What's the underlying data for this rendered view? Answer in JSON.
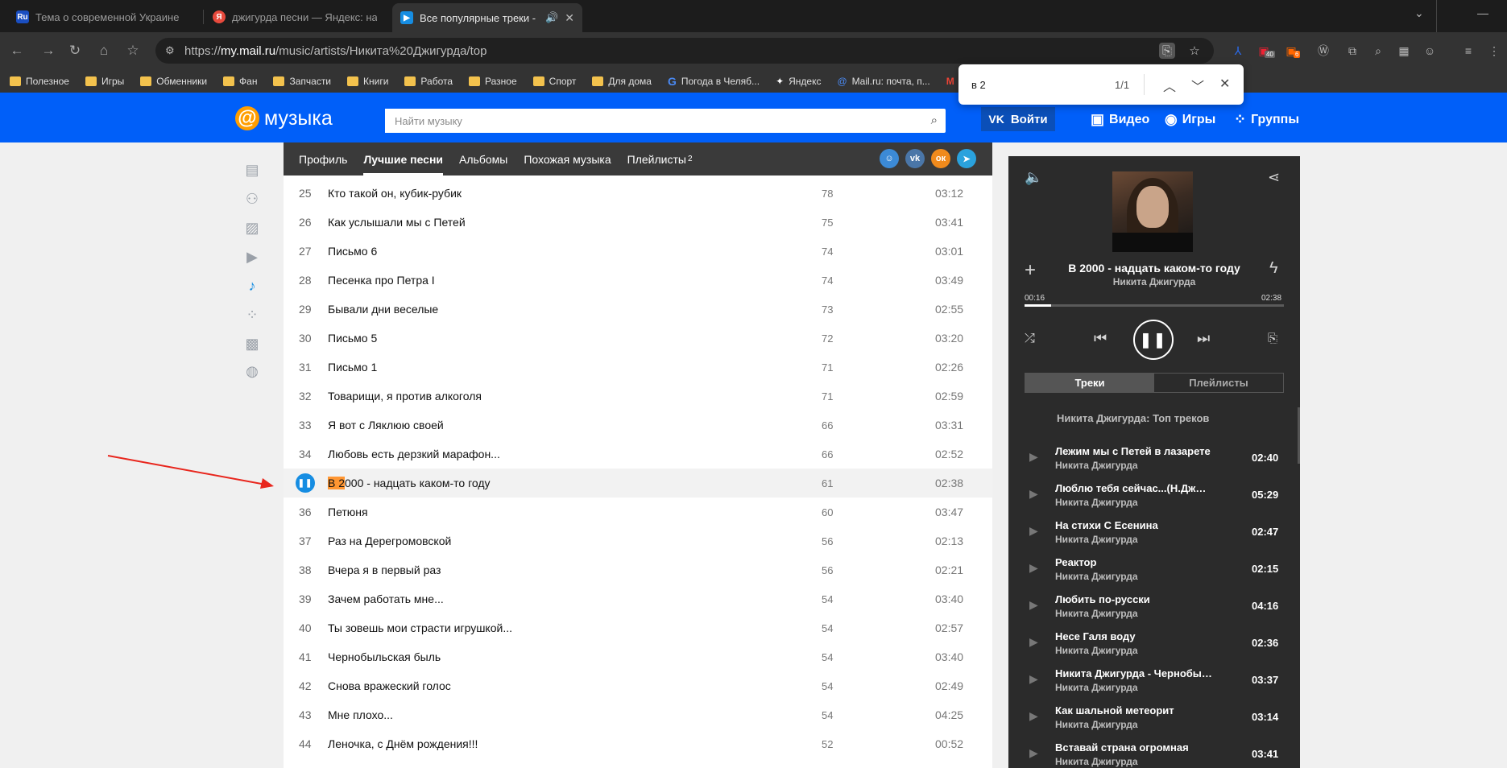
{
  "browser": {
    "tabs": [
      {
        "icon_text": "Ru",
        "icon_color": "#1a4ec0",
        "title": "Тема о современной Украине"
      },
      {
        "icon_text": "Я",
        "icon_color": "#e84a3d",
        "title": "джигурда песни — Яндекс: нашлось"
      },
      {
        "icon_text": "▶",
        "icon_color": "#168de2",
        "title": "Все популярные треки - Н",
        "active": true,
        "audio": "🔊"
      }
    ],
    "url_scheme": "https://",
    "url_host": "my.mail.ru",
    "url_path": "/music/artists/Никита%20Джигурда/top",
    "ext_badge_1": "40",
    "ext_badge_2": "6",
    "bookmarks": [
      "Полезное",
      "Игры",
      "Обменники",
      "Фан",
      "Запчасти",
      "Книги",
      "Работа",
      "Разное",
      "Спорт",
      "Для дома"
    ],
    "bookmark_google": "Погода в Челяб...",
    "bookmark_yandex": "Яндекс",
    "bookmark_mail": "Mail.ru: почта, п...",
    "bookmark_gmail": "g",
    "find": {
      "query": "в 2",
      "count": "1/1"
    }
  },
  "site": {
    "logo_text": "музыка",
    "search_placeholder": "Найти музыку",
    "login_label": "Войти",
    "links": [
      "Видео",
      "Игры",
      "Группы"
    ]
  },
  "subnav": {
    "items": [
      "Профиль",
      "Лучшие песни",
      "Альбомы",
      "Похожая музыка",
      "Плейлисты"
    ],
    "playlists_sup": "2"
  },
  "tracks": [
    {
      "n": "25",
      "title": "Кто такой он, кубик-рубик",
      "plays": "78",
      "dur": "03:12"
    },
    {
      "n": "26",
      "title": "Как услышали мы с Петей",
      "plays": "75",
      "dur": "03:41"
    },
    {
      "n": "27",
      "title": "Письмо 6",
      "plays": "74",
      "dur": "03:01"
    },
    {
      "n": "28",
      "title": "Песенка про Петра I",
      "plays": "74",
      "dur": "03:49"
    },
    {
      "n": "29",
      "title": "Бывали дни веселые",
      "plays": "73",
      "dur": "02:55"
    },
    {
      "n": "30",
      "title": "Письмо 5",
      "plays": "72",
      "dur": "03:20"
    },
    {
      "n": "31",
      "title": "Письмо 1",
      "plays": "71",
      "dur": "02:26"
    },
    {
      "n": "32",
      "title": "Товарищи, я против алкоголя",
      "plays": "71",
      "dur": "02:59"
    },
    {
      "n": "33",
      "title": "Я вот с Ляклюю своей",
      "plays": "66",
      "dur": "03:31"
    },
    {
      "n": "34",
      "title": "Любовь есть дерзкий марафон...",
      "plays": "66",
      "dur": "02:52"
    },
    {
      "n": "35",
      "title_hl": "В 2",
      "title_rest": "000 - надцать каком-то году",
      "plays": "61",
      "dur": "02:38",
      "playing": true
    },
    {
      "n": "36",
      "title": "Петюня",
      "plays": "60",
      "dur": "03:47"
    },
    {
      "n": "37",
      "title": "Раз на Дерегромовской",
      "plays": "56",
      "dur": "02:13"
    },
    {
      "n": "38",
      "title": "Вчера я в первый раз",
      "plays": "56",
      "dur": "02:21"
    },
    {
      "n": "39",
      "title": "Зачем работать мне...",
      "plays": "54",
      "dur": "03:40"
    },
    {
      "n": "40",
      "title": "Ты зовешь мои страсти игрушкой...",
      "plays": "54",
      "dur": "02:57"
    },
    {
      "n": "41",
      "title": "Чернобыльская быль",
      "plays": "54",
      "dur": "03:40"
    },
    {
      "n": "42",
      "title": "Снова вражеский голос",
      "plays": "54",
      "dur": "02:49"
    },
    {
      "n": "43",
      "title": "Мне плохо...",
      "plays": "54",
      "dur": "04:25"
    },
    {
      "n": "44",
      "title": "Леночка, с Днём рождения!!!",
      "plays": "52",
      "dur": "00:52"
    }
  ],
  "player": {
    "title": "В 2000 - надцать каком-то году",
    "artist": "Никита Джигурда",
    "elapsed": "00:16",
    "total": "02:38",
    "progress_fraction": 0.101,
    "tabs": [
      "Треки",
      "Плейлисты"
    ],
    "playlist_title": "Никита Джигурда: Топ треков",
    "queue": [
      {
        "t": "Лежим мы с Петей в лазарете",
        "a": "Никита Джигурда",
        "d": "02:40"
      },
      {
        "t": "Люблю тебя сейчас...(Н.Джигурда-В...",
        "a": "Никита Джигурда",
        "d": "05:29"
      },
      {
        "t": "На стихи С Есенина",
        "a": "Никита Джигурда",
        "d": "02:47"
      },
      {
        "t": "Реактор",
        "a": "Никита Джигурда",
        "d": "02:15"
      },
      {
        "t": "Любить по-русски",
        "a": "Никита Джигурда",
        "d": "04:16"
      },
      {
        "t": "Несе Галя воду",
        "a": "Никита Джигурда",
        "d": "02:36"
      },
      {
        "t": "Никита Джигурда - Чернобыльская ...",
        "a": "Никита Джигурда",
        "d": "03:37"
      },
      {
        "t": "Как шальной метеорит",
        "a": "Никита Джигурда",
        "d": "03:14"
      },
      {
        "t": "Вставай страна огромная",
        "a": "Никита Джигурда",
        "d": "03:41"
      }
    ]
  },
  "colors": {
    "brand_blue": "#005ff9",
    "play_blue": "#168de2",
    "find_highlight": "#ff9632",
    "ok_orange": "#f08a1c",
    "telegram": "#2aa2dd",
    "vk": "#4a76a8"
  }
}
